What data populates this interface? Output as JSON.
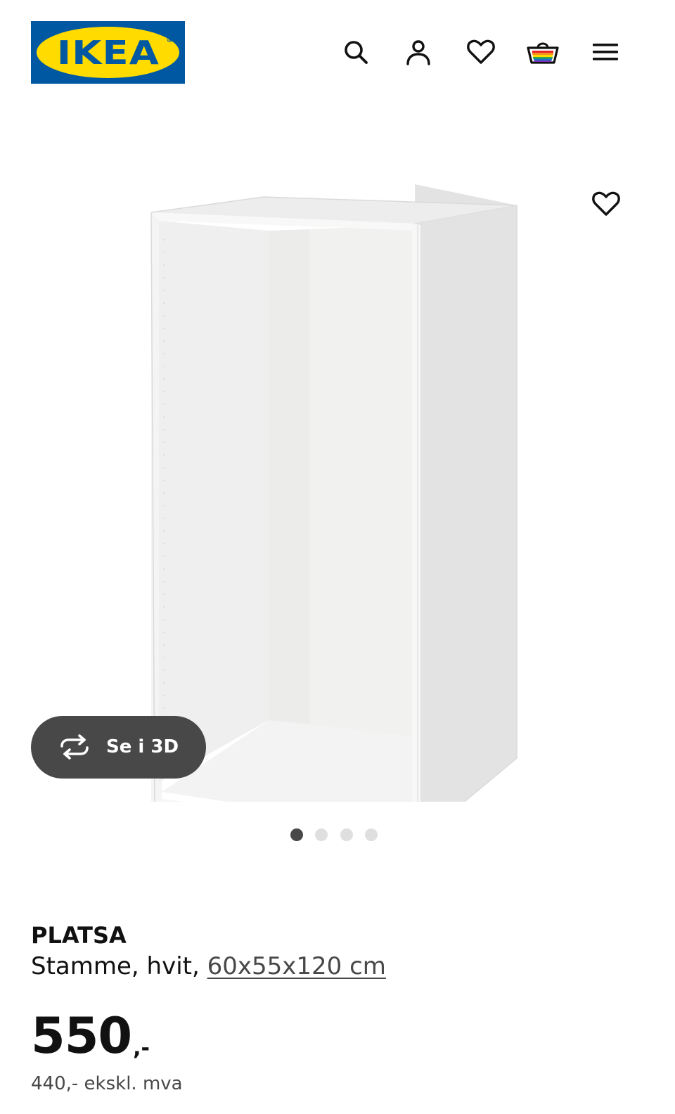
{
  "header": {
    "logo_text": "IKEA",
    "icons": [
      "search-icon",
      "profile-icon",
      "heart-icon",
      "basket-icon",
      "menu-icon"
    ]
  },
  "gallery": {
    "view_3d_label": "Se i 3D",
    "slide_count": 4,
    "active_slide": 1
  },
  "product": {
    "name": "PLATSA",
    "description_prefix": "Stamme, hvit, ",
    "dimensions": "60x55x120 cm",
    "price_main": "550",
    "price_suffix": ",-",
    "price_excl_vat": "440,- ekskl. mva"
  },
  "colors": {
    "ikea_blue": "#0058a3",
    "ikea_yellow": "#ffdb00",
    "dark_button": "#484848",
    "text": "#111111"
  }
}
